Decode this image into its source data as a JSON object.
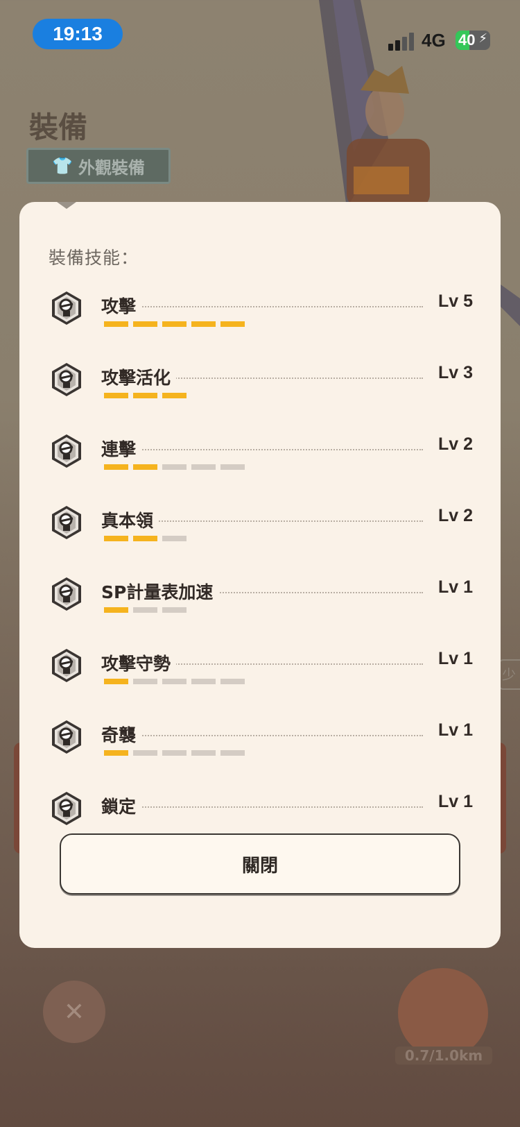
{
  "status_bar": {
    "time": "19:13",
    "network": "4G",
    "battery": "40"
  },
  "background": {
    "page_title": "裝備",
    "appearance_button": "外觀裝備",
    "distance": "0.7/1.0km",
    "side_chip": "少"
  },
  "modal": {
    "heading": "裝備技能：",
    "skills": [
      {
        "name": "攻擊",
        "level": "Lv 5",
        "current": 5,
        "max": 5
      },
      {
        "name": "攻擊活化",
        "level": "Lv 3",
        "current": 3,
        "max": 3
      },
      {
        "name": "連擊",
        "level": "Lv 2",
        "current": 2,
        "max": 5
      },
      {
        "name": "真本領",
        "level": "Lv 2",
        "current": 2,
        "max": 3
      },
      {
        "name": "SP計量表加速",
        "level": "Lv 1",
        "current": 1,
        "max": 3
      },
      {
        "name": "攻擊守勢",
        "level": "Lv 1",
        "current": 1,
        "max": 5
      },
      {
        "name": "奇襲",
        "level": "Lv 1",
        "current": 1,
        "max": 5
      },
      {
        "name": "鎖定",
        "level": "Lv 1",
        "current": 1,
        "max": 0
      }
    ],
    "close_label": "關閉"
  },
  "colors": {
    "bar_on": "#f5b31e",
    "bar_off": "#d4ccc4",
    "modal_bg": "#faf2e8"
  }
}
